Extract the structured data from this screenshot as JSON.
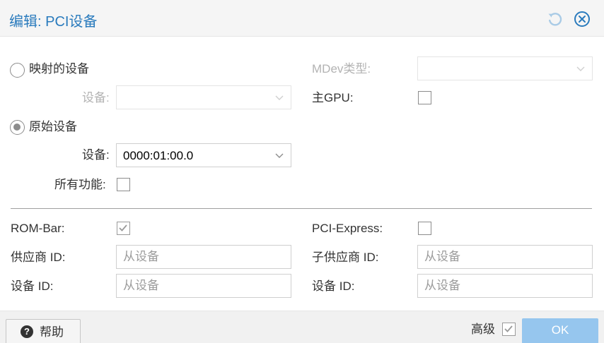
{
  "title": "编辑: PCI设备",
  "mapping": {
    "mapped_device_radio_label": "映射的设备",
    "mapped_device_field_label": "设备:",
    "raw_device_radio_label": "原始设备",
    "raw_device_field_label": "设备:",
    "raw_device_value": "0000:01:00.0",
    "all_functions_label": "所有功能:",
    "mdev_type_label": "MDev类型:",
    "primary_gpu_label": "主GPU:"
  },
  "advanced": {
    "rom_bar_label": "ROM-Bar:",
    "pci_express_label": "PCI-Express:",
    "vendor_id_label": "供应商 ID:",
    "vendor_id_placeholder": "从设备",
    "subsystem_vendor_id_label": "子供应商 ID:",
    "subsystem_vendor_id_placeholder": "从设备",
    "device_id_label": "设备 ID:",
    "device_id_placeholder": "从设备",
    "subsystem_device_id_label": "设备 ID:",
    "subsystem_device_id_placeholder": "从设备"
  },
  "footer": {
    "help_label": "帮助",
    "advanced_label": "高级",
    "ok_label": "OK"
  },
  "state": {
    "mapped_device_selected": false,
    "raw_device_selected": true,
    "all_functions_checked": false,
    "primary_gpu_checked": false,
    "rom_bar_checked": true,
    "pci_express_checked": false,
    "advanced_checked": true
  },
  "colors": {
    "title": "#2a7bbd",
    "ok_button": "#96c6ee",
    "muted_label": "#b3b3b3"
  },
  "icons": {
    "reset": "reset-icon",
    "close": "close-icon",
    "help": "question-circle-icon",
    "dropdown": "chevron-down-icon",
    "check": "checkmark-icon"
  }
}
